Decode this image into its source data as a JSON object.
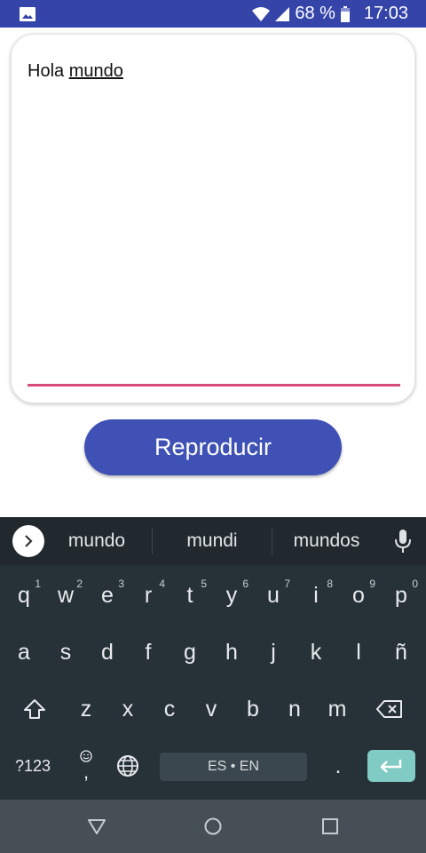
{
  "status_bar": {
    "notification_icon": "image-icon",
    "battery": "68 %",
    "time": "17:03"
  },
  "editor": {
    "text_plain": "Hola ",
    "text_underlined": "mundo"
  },
  "play_button": {
    "label": "Reproducir"
  },
  "keyboard": {
    "suggestions": [
      "mundo",
      "mundi",
      "mundos"
    ],
    "row1": [
      {
        "key": "q",
        "hint": "1"
      },
      {
        "key": "w",
        "hint": "2"
      },
      {
        "key": "e",
        "hint": "3"
      },
      {
        "key": "r",
        "hint": "4"
      },
      {
        "key": "t",
        "hint": "5"
      },
      {
        "key": "y",
        "hint": "6"
      },
      {
        "key": "u",
        "hint": "7"
      },
      {
        "key": "i",
        "hint": "8"
      },
      {
        "key": "o",
        "hint": "9"
      },
      {
        "key": "p",
        "hint": "0"
      }
    ],
    "row2": [
      "a",
      "s",
      "d",
      "f",
      "g",
      "h",
      "j",
      "k",
      "l",
      "ñ"
    ],
    "row3": [
      "z",
      "x",
      "c",
      "v",
      "b",
      "n",
      "m"
    ],
    "symbols_key": "?123",
    "comma_key": ",",
    "spacebar_label": "ES • EN",
    "period_key": "."
  }
}
